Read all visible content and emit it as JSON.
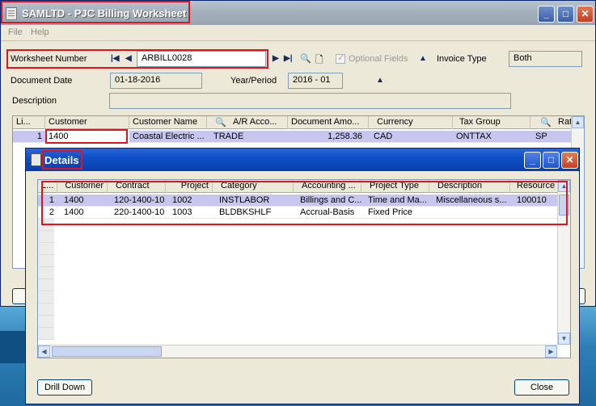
{
  "window": {
    "title": "SAMLTD - PJC Billing Worksheet",
    "menu": [
      "File",
      "Help"
    ]
  },
  "form": {
    "worksheet_label": "Worksheet Number",
    "worksheet_value": "ARBILL0028",
    "optional_fields_label": "Optional Fields",
    "invoice_type_label": "Invoice Type",
    "invoice_type_value": "Both",
    "document_date_label": "Document Date",
    "document_date_value": "01-18-2016",
    "year_period_label": "Year/Period",
    "year_period_value": "2016 - 01",
    "description_label": "Description",
    "description_value": ""
  },
  "main_grid": {
    "columns": [
      "Li...",
      "Customer",
      "Customer Name",
      "A/R Acco...",
      "Document Amo...",
      "Currency",
      "Tax Group",
      "Rat"
    ],
    "rows": [
      {
        "line": "1",
        "customer": "1400",
        "customer_name": "Coastal Electric ...",
        "ar_account": "TRADE",
        "document_amount": "1,258.36",
        "currency": "CAD",
        "tax_group": "ONTTAX",
        "rate": "SP"
      }
    ]
  },
  "details": {
    "title": "Details",
    "columns": [
      "L...",
      "Customer",
      "Contract",
      "Project",
      "Category",
      "Accounting ...",
      "Project Type",
      "Description",
      "Resource"
    ],
    "rows": [
      {
        "line": "1",
        "customer": "1400",
        "contract": "120-1400-10",
        "project": "1002",
        "category": "INSTLABOR",
        "accounting": "Billings and C...",
        "project_type": "Time and Ma...",
        "description": "Miscellaneous s...",
        "resource": "100010"
      },
      {
        "line": "2",
        "customer": "1400",
        "contract": "220-1400-10",
        "project": "1003",
        "category": "BLDBKSHLF",
        "accounting": "Accrual-Basis",
        "project_type": "Fixed Price",
        "description": "",
        "resource": ""
      }
    ],
    "drill_down_label": "Drill Down",
    "close_label": "Close"
  },
  "icons": {
    "minimize": "minimize-icon",
    "maximize": "maximize-icon",
    "close": "close-icon",
    "first": "first-record-icon",
    "prev": "previous-record-icon",
    "next": "next-record-icon",
    "last": "last-record-icon",
    "finder": "search-icon",
    "new": "new-document-icon"
  }
}
